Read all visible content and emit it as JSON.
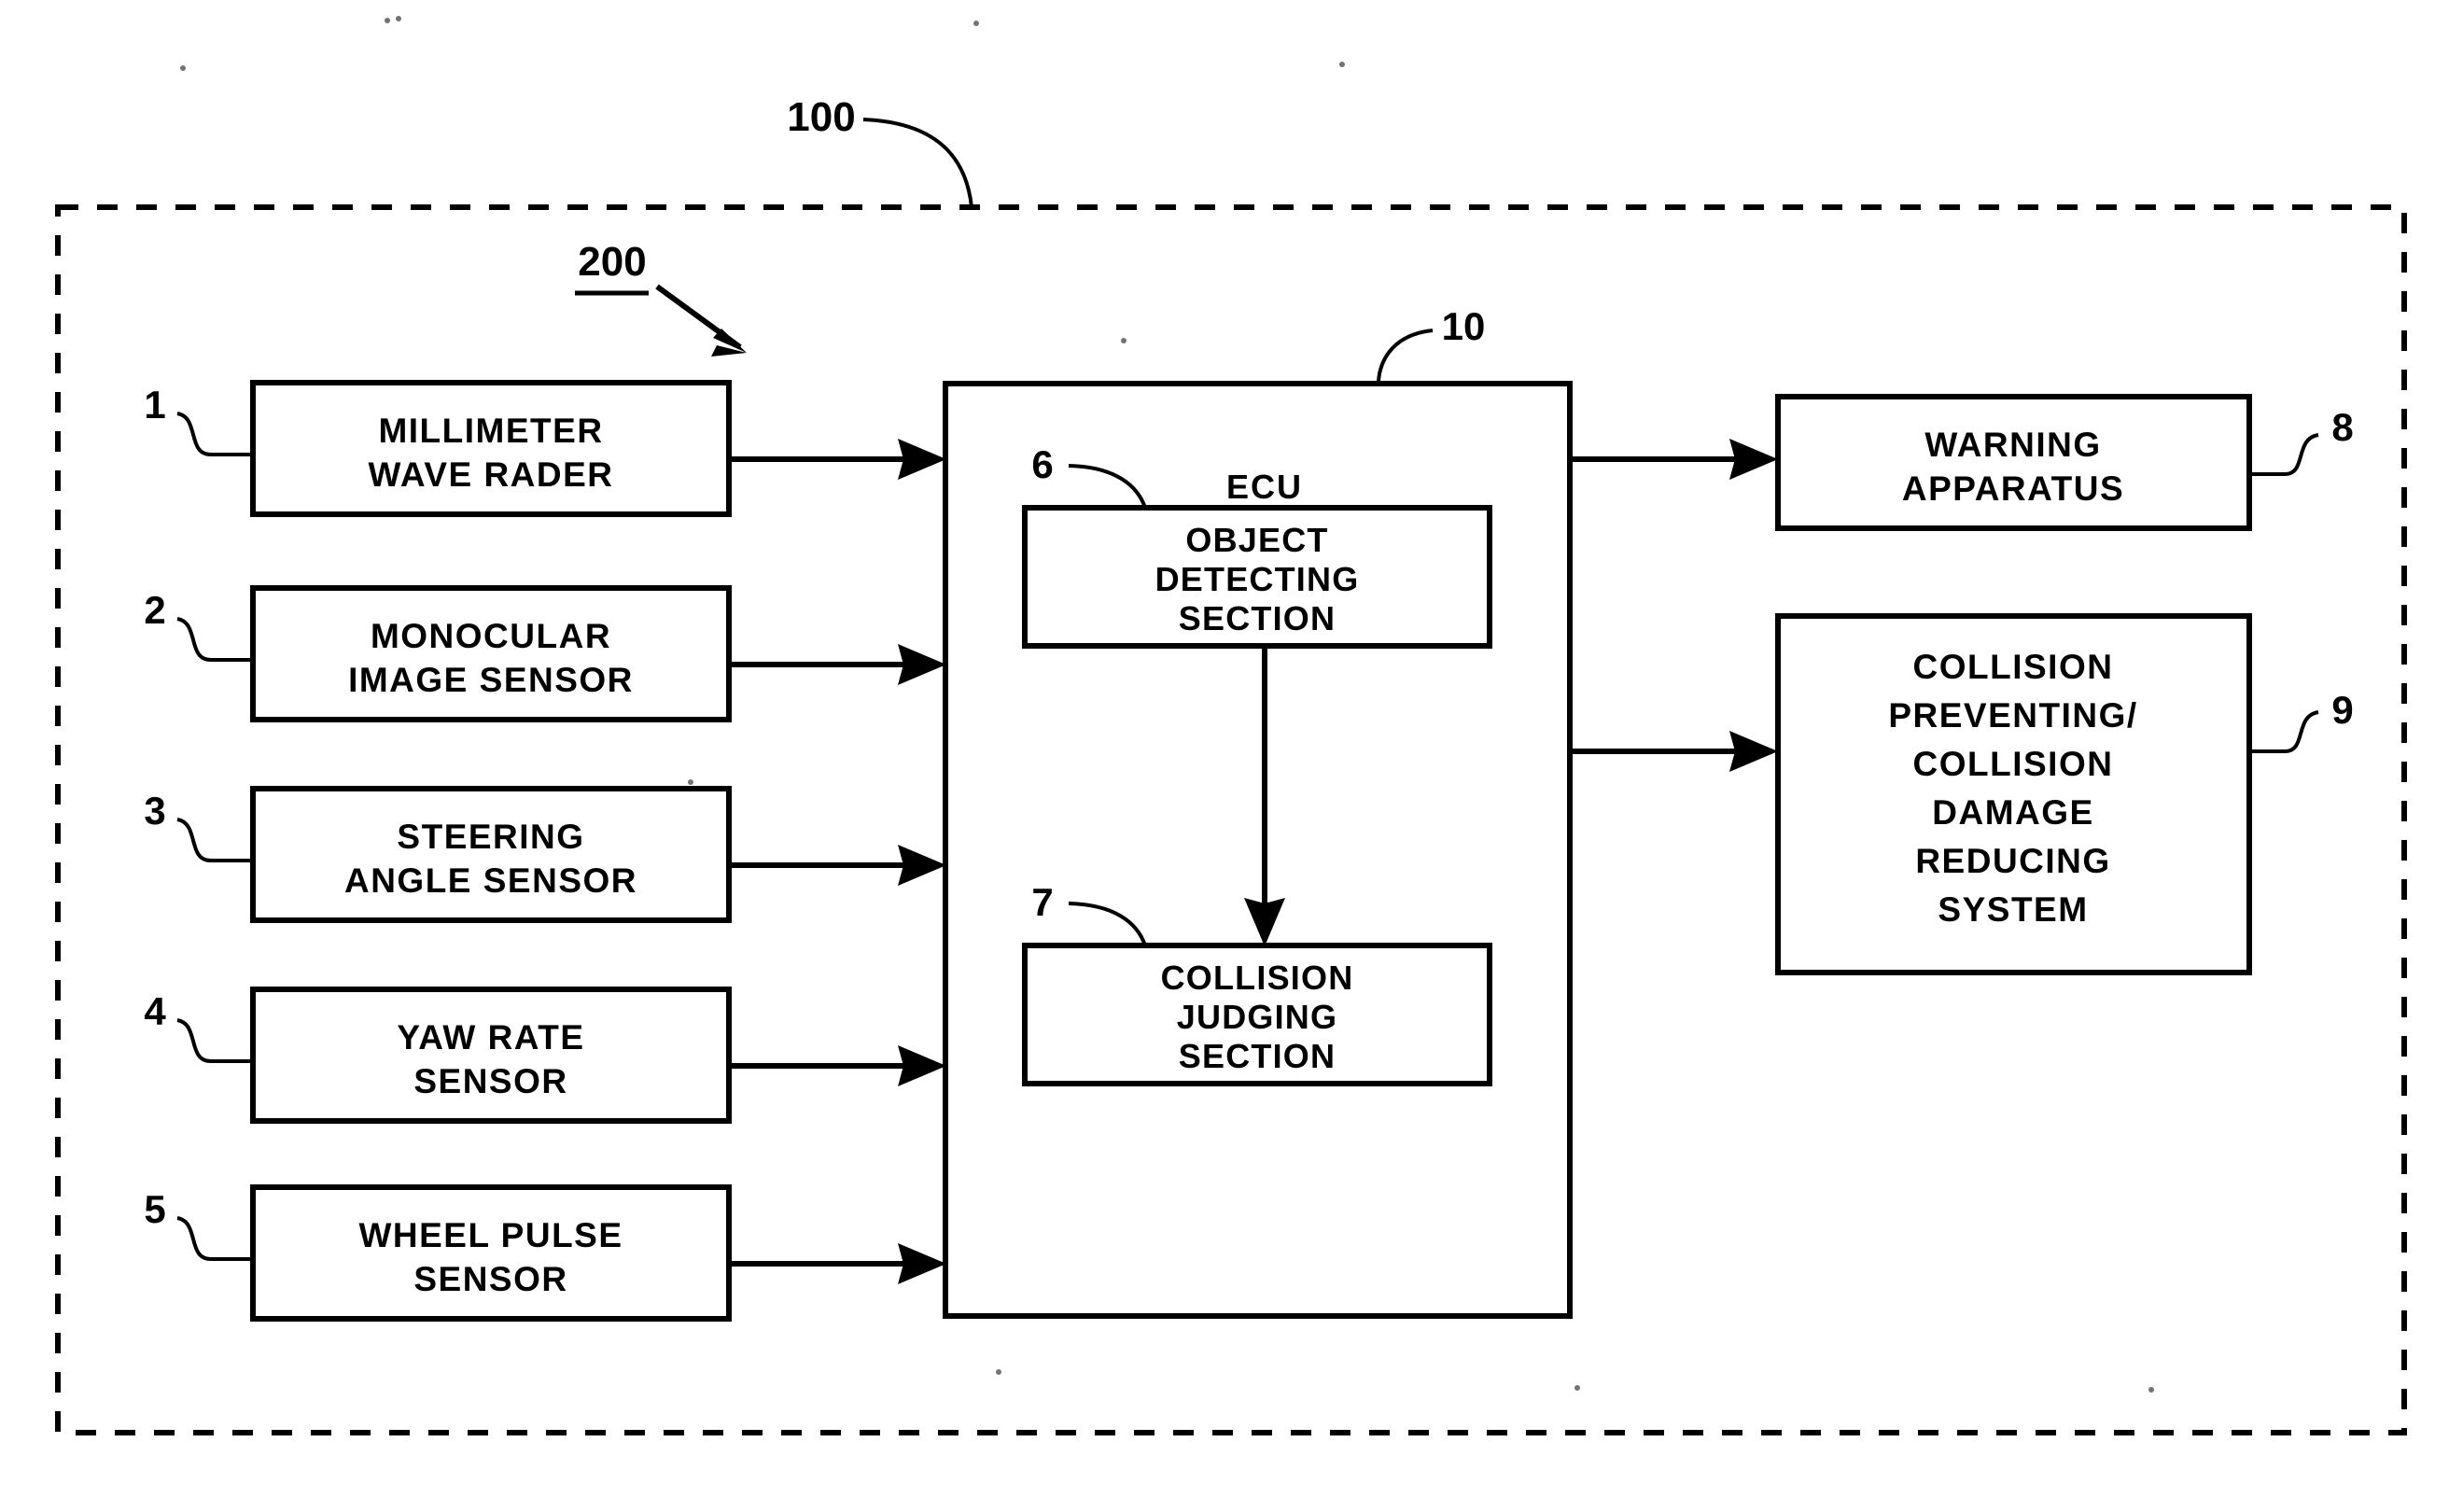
{
  "figure": {
    "type": "patent-block-diagram",
    "system_ref": "100",
    "subsystem_ref": "200",
    "background_color": "#ffffff",
    "line_color": "#000000"
  },
  "inputs": [
    {
      "ref": "1",
      "label_line1": "MILLIMETER",
      "label_line2": "WAVE RADER"
    },
    {
      "ref": "2",
      "label_line1": "MONOCULAR",
      "label_line2": "IMAGE SENSOR"
    },
    {
      "ref": "3",
      "label_line1": "STEERING",
      "label_line2": "ANGLE SENSOR"
    },
    {
      "ref": "4",
      "label_line1": "YAW RATE",
      "label_line2": "SENSOR"
    },
    {
      "ref": "5",
      "label_line1": "WHEEL PULSE",
      "label_line2": "SENSOR"
    }
  ],
  "ecu": {
    "ref": "10",
    "title": "ECU",
    "sections": [
      {
        "ref": "6",
        "label_line1": "OBJECT",
        "label_line2": "DETECTING",
        "label_line3": "SECTION"
      },
      {
        "ref": "7",
        "label_line1": "COLLISION",
        "label_line2": "JUDGING",
        "label_line3": "SECTION"
      }
    ]
  },
  "outputs": [
    {
      "ref": "8",
      "lines": [
        "WARNING",
        "APPARATUS"
      ]
    },
    {
      "ref": "9",
      "lines": [
        "COLLISION",
        "PREVENTING/",
        "COLLISION",
        "DAMAGE",
        "REDUCING",
        "SYSTEM"
      ]
    }
  ]
}
